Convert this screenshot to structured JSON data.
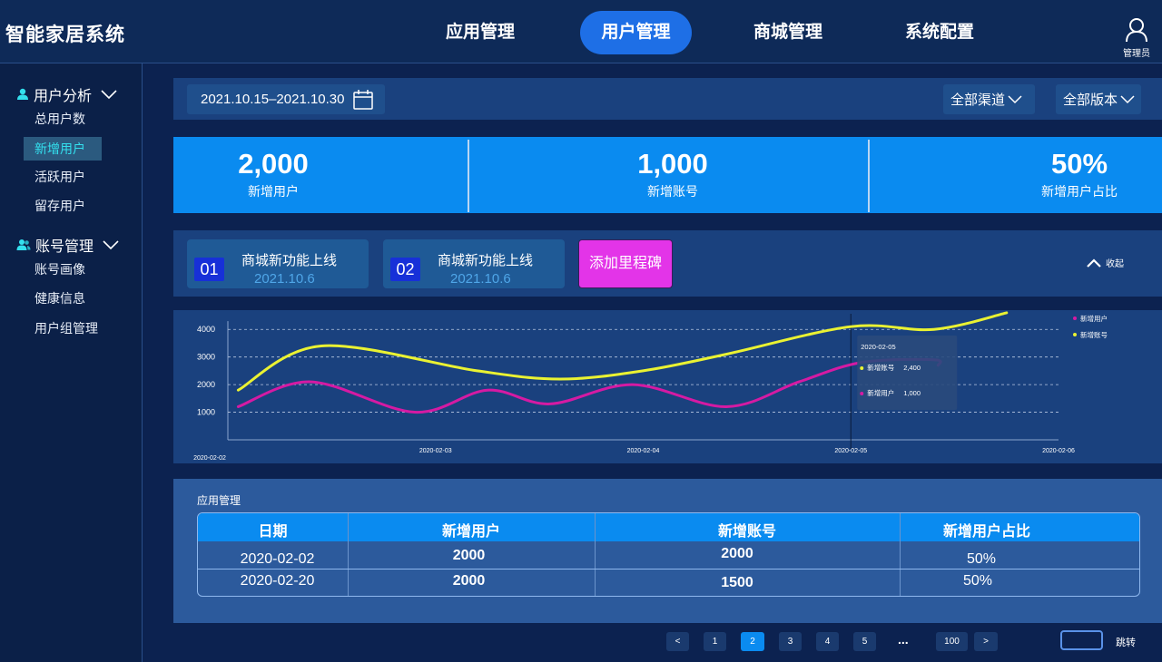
{
  "app": {
    "title": "智能家居系统"
  },
  "nav": [
    {
      "label": "应用管理",
      "active": false
    },
    {
      "label": "用户管理",
      "active": true
    },
    {
      "label": "商城管理",
      "active": false
    },
    {
      "label": "系统配置",
      "active": false
    }
  ],
  "admin": {
    "label": "管理员",
    "icon": "user-icon"
  },
  "sidebar": {
    "groups": [
      {
        "label": "用户分析",
        "icon": "user-icon",
        "items": [
          "总用户数",
          "新增用户",
          "活跃用户",
          "留存用户"
        ],
        "active_item": "新增用户"
      },
      {
        "label": "账号管理",
        "icon": "users-icon",
        "items": [
          "账号画像",
          "健康信息",
          "用户组管理"
        ]
      }
    ]
  },
  "filters": {
    "date_range": "2021.10.15–2021.10.30",
    "channel": "全部渠道",
    "version": "全部版本"
  },
  "stats": [
    {
      "value": "2,000",
      "label": "新增用户"
    },
    {
      "value": "1,000",
      "label": "新增账号"
    },
    {
      "value": "50%",
      "label": "新增用户占比"
    }
  ],
  "milestones": [
    {
      "index": "01",
      "title": "商城新功能上线",
      "date": "2021.10.6"
    },
    {
      "index": "02",
      "title": "商城新功能上线",
      "date": "2021.10.6"
    }
  ],
  "add_milestone_label": "添加里程碑",
  "collapse_label": "收起",
  "chart_data": {
    "type": "line",
    "x": [
      "2020-02-02",
      "2020-02-03",
      "2020-02-04",
      "2020-02-05",
      "2020-02-06"
    ],
    "y_ticks": [
      1000,
      2000,
      3000,
      4000
    ],
    "ylim": [
      0,
      4500
    ],
    "grid": "dashed horizontal",
    "legend": "top-right",
    "series": [
      {
        "name": "新增用户",
        "color": "#d51aa3",
        "points": [
          [
            0.05,
            1200
          ],
          [
            0.4,
            2100
          ],
          [
            0.9,
            1000
          ],
          [
            1.25,
            1800
          ],
          [
            1.55,
            1300
          ],
          [
            1.95,
            2000
          ],
          [
            2.4,
            1200
          ],
          [
            2.75,
            2100
          ],
          [
            3.05,
            2800
          ],
          [
            3.4,
            2900
          ],
          [
            3.42,
            2700
          ]
        ]
      },
      {
        "name": "新增账号",
        "color": "#eaf232",
        "points": [
          [
            0.05,
            1800
          ],
          [
            0.45,
            3400
          ],
          [
            1.2,
            2500
          ],
          [
            1.6,
            2200
          ],
          [
            2.0,
            2500
          ],
          [
            2.4,
            3100
          ],
          [
            3.0,
            4100
          ],
          [
            3.4,
            4000
          ],
          [
            3.75,
            4600
          ]
        ]
      }
    ],
    "tooltip": {
      "date": "2020-02-05",
      "rows": [
        {
          "name": "新增账号",
          "value": "2,400"
        },
        {
          "name": "新增用户",
          "value": "1,000"
        }
      ]
    }
  },
  "table": {
    "title": "应用管理",
    "columns": [
      "日期",
      "新增用户",
      "新增账号",
      "新增用户占比"
    ],
    "rows": [
      [
        "2020-02-02",
        "2000",
        "2000",
        "50%"
      ],
      [
        "2020-02-20",
        "2000",
        "1500",
        "50%"
      ]
    ]
  },
  "pagination": {
    "prev": "<",
    "next": ">",
    "pages": [
      "1",
      "2",
      "3",
      "4",
      "5"
    ],
    "ellipsis": "...",
    "last": "100",
    "current": "2",
    "jump_label": "跳转"
  },
  "colors": {
    "accent": "#1e6fe6",
    "stat_bg": "#0a8bf0",
    "magenta": "#e334e8"
  }
}
